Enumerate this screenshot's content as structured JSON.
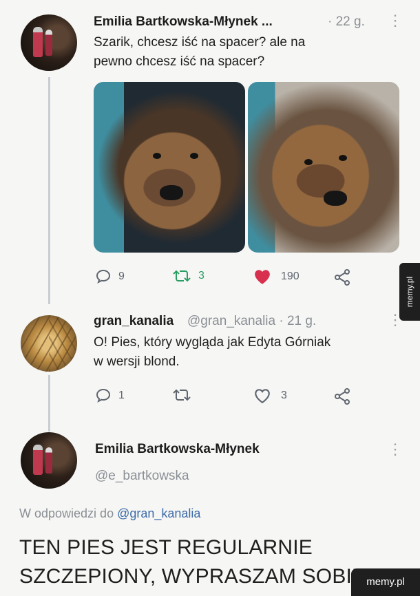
{
  "tweet1": {
    "author": "Emilia Bartkowska-Młynek ...",
    "time": "· 22 g.",
    "text_lines": [
      "Szarik, chcesz iść na spacer? ale na",
      "pewno chcesz iść na spacer?"
    ],
    "replies": "9",
    "retweets": "3",
    "likes": "190",
    "icons": {
      "reply": "comment-icon",
      "retweet": "retweet-icon",
      "like": "heart-icon",
      "share": "share-icon",
      "more": "more-vertical-icon"
    },
    "colors": {
      "retweet": "#2a9d62",
      "like": "#d8304f"
    }
  },
  "tweet2": {
    "author": "gran_kanalia",
    "handle_time": "@gran_kanalia · 21 g.",
    "text_lines": [
      "O! Pies, który wygląda jak Edyta Górniak",
      "w wersji blond."
    ],
    "replies": "1",
    "retweets": "",
    "likes": "3"
  },
  "tweet3": {
    "author": "Emilia Bartkowska-Młynek",
    "handle": "@e_bartkowska",
    "reply_prefix": "W odpowiedzi do",
    "reply_mention": "@gran_kanalia",
    "text_lines": [
      "TEN PIES JEST REGULARNIE",
      "SZCZEPIONY, WYPRASZAM SOBIE"
    ]
  },
  "watermarks": {
    "side": "memy.pl",
    "corner": "memy.pl"
  },
  "colors": {
    "background": "#f6f6f4",
    "thread_line": "#c9cdd2",
    "mention": "#3b6aa8"
  }
}
